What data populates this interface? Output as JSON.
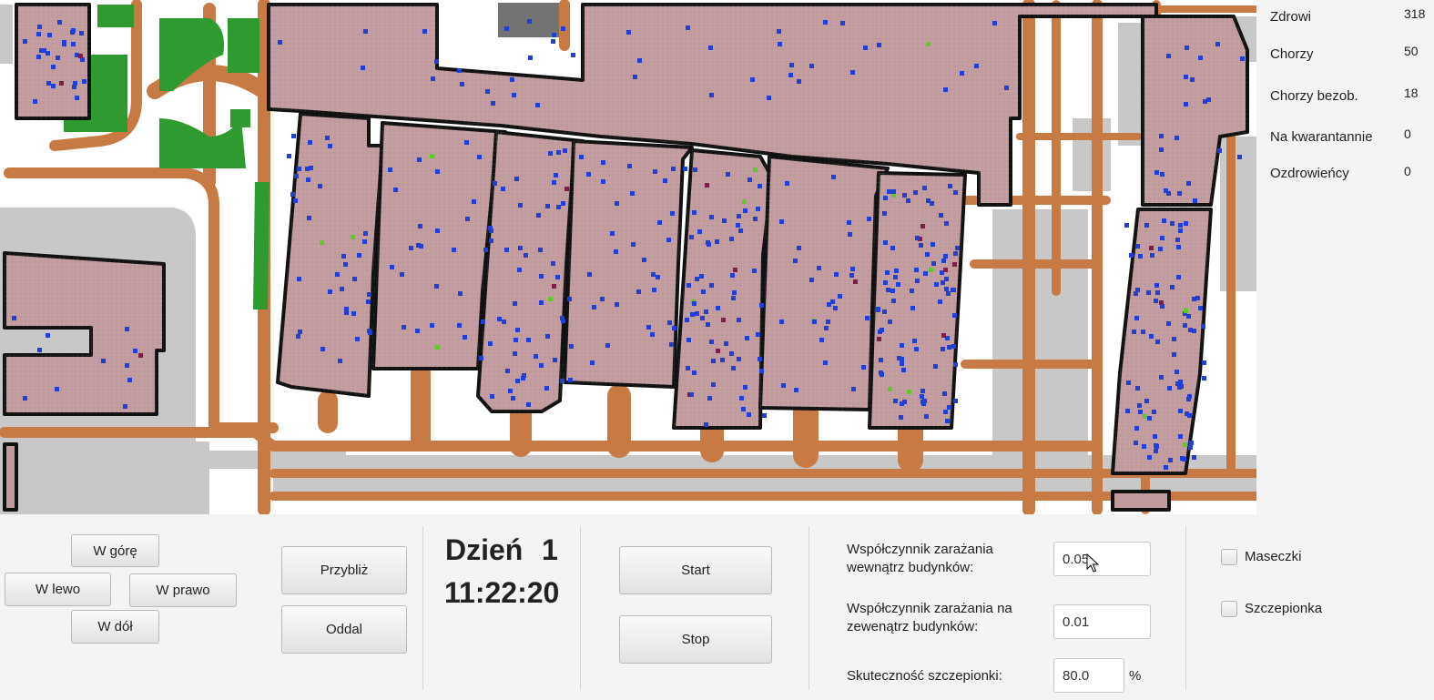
{
  "stats": [
    {
      "label": "Zdrowi",
      "value": "318"
    },
    {
      "label": "Chorzy",
      "value": "50"
    },
    {
      "label": "Chorzy bezob.",
      "value": "18"
    },
    {
      "label": "Na kwarantannie",
      "value": "0"
    },
    {
      "label": "Ozdrowieńcy",
      "value": "0"
    }
  ],
  "navigation": {
    "up": "W górę",
    "left": "W lewo",
    "right": "W prawo",
    "down": "W dół"
  },
  "zoom": {
    "zoom_in": "Przybliż",
    "zoom_out": "Oddal"
  },
  "clock": {
    "day_label": "Dzień",
    "day_number": "1",
    "time": "11:22:20"
  },
  "controls": {
    "start": "Start",
    "stop": "Stop"
  },
  "parameters": {
    "indoor_label_line1": "Współczynnik zarażania",
    "indoor_label_line2": "wewnątrz budynków:",
    "indoor_value": "0.05",
    "outdoor_label_line1": "Współczynnik zarażania na",
    "outdoor_label_line2": "zewenątrz budynków:",
    "outdoor_value": "0.01",
    "vaccine_label": "Skuteczność szczepionki:",
    "vaccine_value": "80.0",
    "vaccine_unit": "%"
  },
  "options": {
    "masks": "Maseczki",
    "vaccine": "Szczepionka"
  },
  "colors": {
    "building": "#c09a9c",
    "path": "#c87a45",
    "road": "#c8c8c8",
    "grass": "#2f9a30",
    "healthy": "#1f3fd6",
    "asymptomatic": "#60c82a",
    "sick": "#7a1e4a"
  }
}
